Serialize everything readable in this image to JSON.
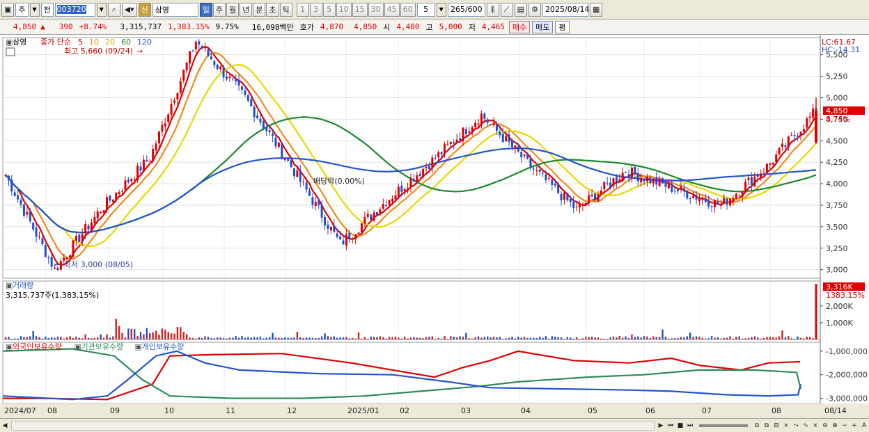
{
  "toolbar": {
    "type_select": "주",
    "mode_select": "전",
    "code": "003720",
    "name_badge": "신",
    "stock_name": "삼영",
    "periods": [
      "일",
      "주",
      "월",
      "년",
      "분",
      "초",
      "틱"
    ],
    "active_period": "일",
    "intervals": [
      "1",
      "3",
      "5",
      "10",
      "15",
      "30",
      "45",
      "60"
    ],
    "interval_input": "5",
    "count": "265",
    "count_max": "/600",
    "date": "2025/08/14"
  },
  "quote": {
    "price": "4,850",
    "change_arrow": "▲",
    "change": "390",
    "change_pct": "+8.74%",
    "volume": "3,315,737",
    "volume_ratio": "1,383.15%",
    "turnover": "9.75%",
    "amount": "16,098백만",
    "ask_label": "호가",
    "ask": "4,870",
    "bid": "4,850",
    "open_label": "시",
    "open": "4,480",
    "high_label": "고",
    "high": "5,000",
    "low_label": "저",
    "low": "4,465",
    "buy_button": "매수",
    "sell_button": "매도",
    "avg_button": "평"
  },
  "price_pane": {
    "stock_label": "삼영",
    "ma_title": "종가 단순",
    "ma_periods": [
      {
        "label": "5",
        "color": "#e00000"
      },
      {
        "label": "10",
        "color": "#f08a1c"
      },
      {
        "label": "20",
        "color": "#e8d800"
      },
      {
        "label": "60",
        "color": "#1a8a2a"
      },
      {
        "label": "120",
        "color": "#2255d0"
      }
    ],
    "high_annotation": "최고 5,660 (09/24)",
    "low_annotation": "최저 3,000 (08/05)",
    "dividend_annotation": "배당락(0.00%)",
    "lc_label": "LC:61.67",
    "hc_label": "HC:-14.31",
    "y_ticks": [
      "5,500",
      "5,250",
      "5,000",
      "4,750",
      "4,500",
      "4,250",
      "4,000",
      "3,750",
      "3,500",
      "3,250",
      "3,000"
    ],
    "current_price_tag": "4,850",
    "current_pct_tag": "8.74%"
  },
  "volume_pane": {
    "title": "거래량",
    "value_text": "3,315,737주(1,383.15%)",
    "y_ticks": [
      "2,000K",
      "1,000K"
    ],
    "current_tag": "3,316K",
    "current_pct": "1383.15%"
  },
  "holding_pane": {
    "legend": [
      {
        "label": "외국인보유수량",
        "color": "#e00000"
      },
      {
        "label": "기관보유수량",
        "color": "#2e8b57"
      },
      {
        "label": "개인보유수량",
        "color": "#2255d0"
      }
    ],
    "y_ticks": [
      "-1,000,000",
      "-2,000,000",
      "-3,000,000"
    ]
  },
  "x_axis": {
    "labels": [
      "2024/07",
      "08",
      "09",
      "10",
      "11",
      "12",
      "2025/01",
      "02",
      "03",
      "04",
      "05",
      "06",
      "07",
      "08",
      "08/14"
    ]
  },
  "chart_data": {
    "type": "candlestick",
    "period": "daily",
    "date_range": [
      "2024/07",
      "2025/08/14"
    ],
    "y_range": [
      2900,
      5700
    ],
    "price_path": [
      {
        "date": "2024/07",
        "close": 4100
      },
      {
        "date": "2024/08/05",
        "close": 3000
      },
      {
        "date": "2024/08",
        "close": 3700
      },
      {
        "date": "2024/09",
        "close": 4300
      },
      {
        "date": "2024/09/24",
        "close": 5660
      },
      {
        "date": "2024/10",
        "close": 5000
      },
      {
        "date": "2024/11",
        "close": 4200
      },
      {
        "date": "2024/12",
        "close": 3300
      },
      {
        "date": "2025/01",
        "close": 3800
      },
      {
        "date": "2025/02",
        "close": 4300
      },
      {
        "date": "2025/02/late",
        "close": 4800
      },
      {
        "date": "2025/03",
        "close": 4200
      },
      {
        "date": "2025/04",
        "close": 3700
      },
      {
        "date": "2025/05",
        "close": 4150
      },
      {
        "date": "2025/06",
        "close": 3950
      },
      {
        "date": "2025/07",
        "close": 3750
      },
      {
        "date": "2025/08",
        "close": 4200
      },
      {
        "date": "2025/08/14",
        "close": 4850
      }
    ],
    "last": {
      "open": 4480,
      "high": 5000,
      "low": 4465,
      "close": 4850
    }
  }
}
